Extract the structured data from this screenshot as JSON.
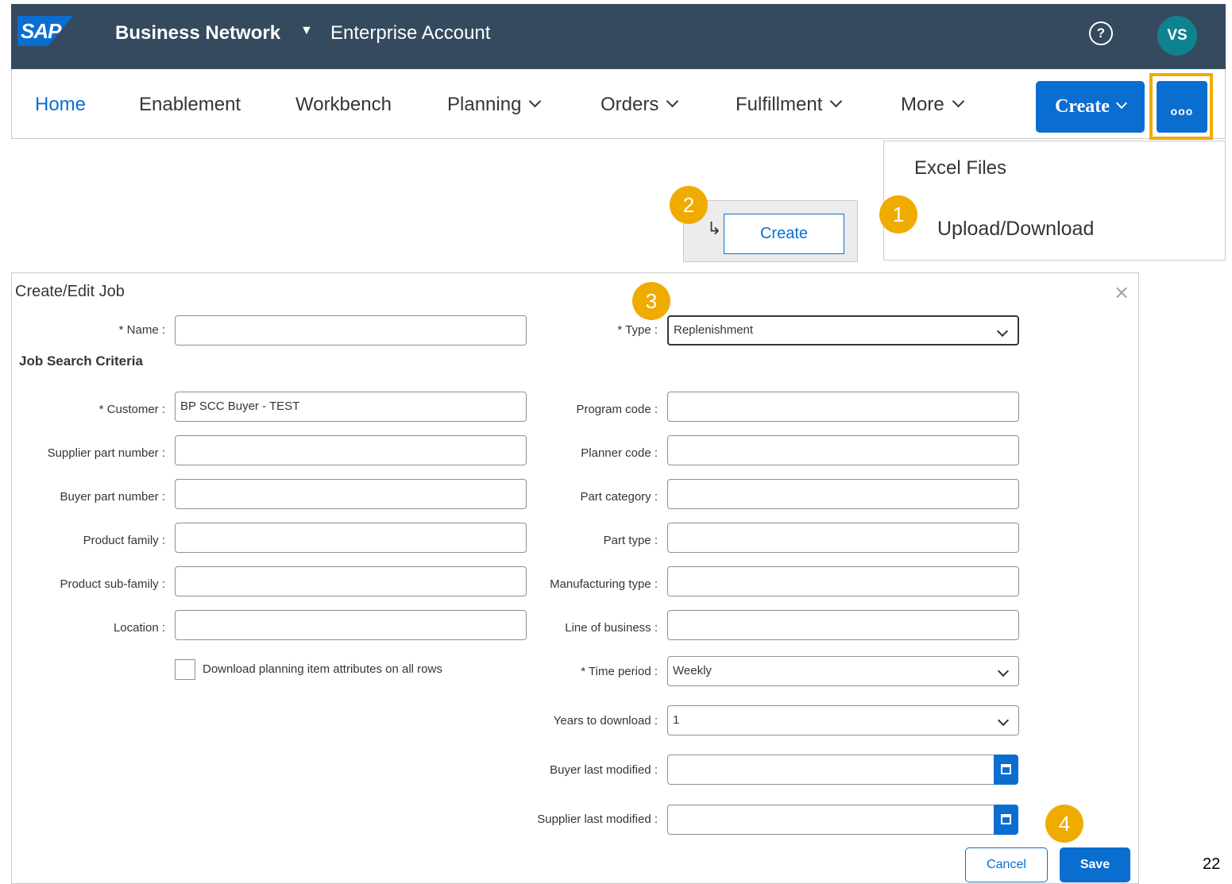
{
  "header": {
    "logo": "SAP",
    "product": "Business Network",
    "account": "Enterprise Account",
    "help_icon": "?",
    "avatar_initials": "VS"
  },
  "nav": {
    "items": [
      "Home",
      "Enablement",
      "Workbench",
      "Planning",
      "Orders",
      "Fulfillment",
      "More"
    ],
    "create_label": "Create",
    "more_label": "ooo"
  },
  "menu": {
    "excel_files": "Excel Files",
    "upload_download": "Upload/Download"
  },
  "submenu": {
    "arrow": "↳",
    "create_label": "Create"
  },
  "steps": [
    "1",
    "2",
    "3",
    "4"
  ],
  "dialog": {
    "title": "Create/Edit Job",
    "close": "×",
    "section": "Job Search Criteria",
    "name_label": "* Name :",
    "name_value": "",
    "type_label": "* Type :",
    "type_value": "Replenishment",
    "left_fields": [
      {
        "label": "* Customer :",
        "value": "BP SCC Buyer - TEST"
      },
      {
        "label": "Supplier part number :",
        "value": ""
      },
      {
        "label": "Buyer part number :",
        "value": ""
      },
      {
        "label": "Product family :",
        "value": ""
      },
      {
        "label": "Product sub-family :",
        "value": ""
      },
      {
        "label": "Location :",
        "value": ""
      }
    ],
    "right_fields": [
      {
        "label": "Program code :",
        "value": ""
      },
      {
        "label": "Planner code :",
        "value": ""
      },
      {
        "label": "Part category :",
        "value": ""
      },
      {
        "label": "Part type :",
        "value": ""
      },
      {
        "label": "Manufacturing type :",
        "value": ""
      },
      {
        "label": "Line of business :",
        "value": ""
      }
    ],
    "checkbox_label": "Download planning item attributes on all rows",
    "time_period_label": "* Time period :",
    "time_period_value": "Weekly",
    "years_label": "Years to download :",
    "years_value": "1",
    "buyer_modified_label": "Buyer last modified :",
    "supplier_modified_label": "Supplier last modified :",
    "cancel_label": "Cancel",
    "save_label": "Save"
  },
  "page_number": "22",
  "colors": {
    "shell": "#354a5f",
    "accent": "#0a6ed1",
    "step": "#f0ab00",
    "avatar": "#0f828f"
  }
}
